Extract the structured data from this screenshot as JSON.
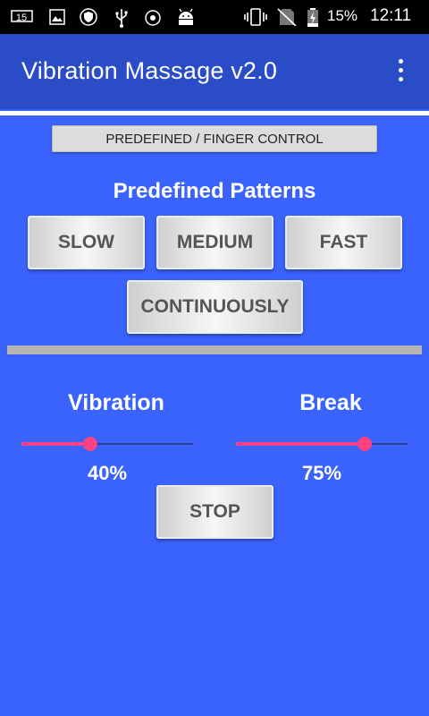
{
  "status_bar": {
    "notification_badge": "15",
    "battery_percent": "15%",
    "time": "12:11"
  },
  "app_bar": {
    "title": "Vibration Massage v2.0",
    "overflow_icon": "more-vert-icon"
  },
  "mode_toggle": {
    "label": "PREDEFINED / FINGER CONTROL"
  },
  "patterns": {
    "title": "Predefined Patterns",
    "buttons": [
      {
        "label": "SLOW"
      },
      {
        "label": "MEDIUM"
      },
      {
        "label": "FAST"
      },
      {
        "label": "CONTINUOUSLY"
      }
    ]
  },
  "controls": {
    "vibration": {
      "label": "Vibration",
      "value": "40%",
      "level": 0.4
    },
    "break": {
      "label": "Break",
      "value": "75%",
      "level": 0.75
    },
    "stop_label": "STOP"
  },
  "colors": {
    "background": "#3a63fd",
    "app_bar": "#2a4cc7",
    "accent": "#ff4081"
  }
}
